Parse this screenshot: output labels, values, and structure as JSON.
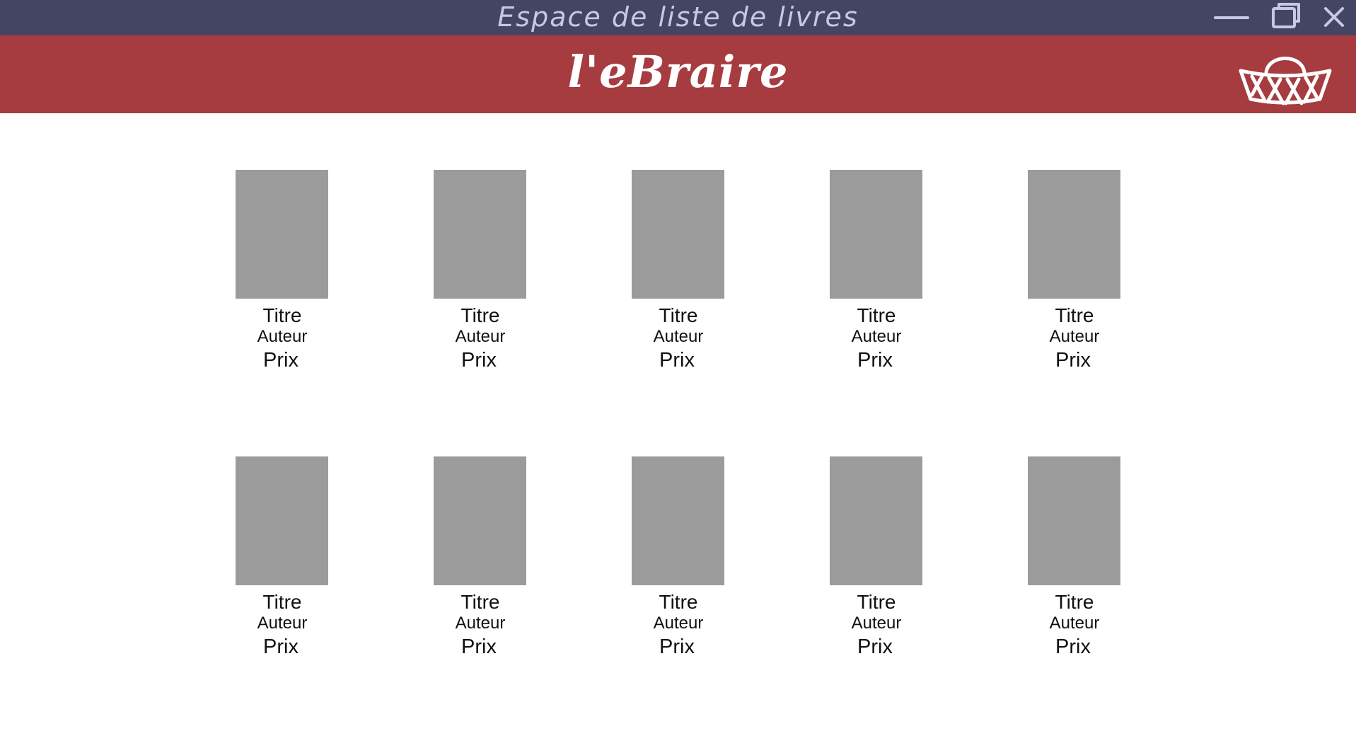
{
  "window": {
    "title": "Espace de liste de livres",
    "titlebar_color": "#444562",
    "controls": [
      "minimize-icon",
      "restore-icon",
      "close-icon"
    ]
  },
  "header": {
    "logo": "l'eBraire",
    "brand_color": "#a63c40",
    "basket_icon": "basket-icon"
  },
  "books": [
    {
      "title": "Titre",
      "author": "Auteur",
      "price": "Prix"
    },
    {
      "title": "Titre",
      "author": "Auteur",
      "price": "Prix"
    },
    {
      "title": "Titre",
      "author": "Auteur",
      "price": "Prix"
    },
    {
      "title": "Titre",
      "author": "Auteur",
      "price": "Prix"
    },
    {
      "title": "Titre",
      "author": "Auteur",
      "price": "Prix"
    },
    {
      "title": "Titre",
      "author": "Auteur",
      "price": "Prix"
    },
    {
      "title": "Titre",
      "author": "Auteur",
      "price": "Prix"
    },
    {
      "title": "Titre",
      "author": "Auteur",
      "price": "Prix"
    },
    {
      "title": "Titre",
      "author": "Auteur",
      "price": "Prix"
    },
    {
      "title": "Titre",
      "author": "Auteur",
      "price": "Prix"
    }
  ],
  "cover_color": "#9b9b9b"
}
